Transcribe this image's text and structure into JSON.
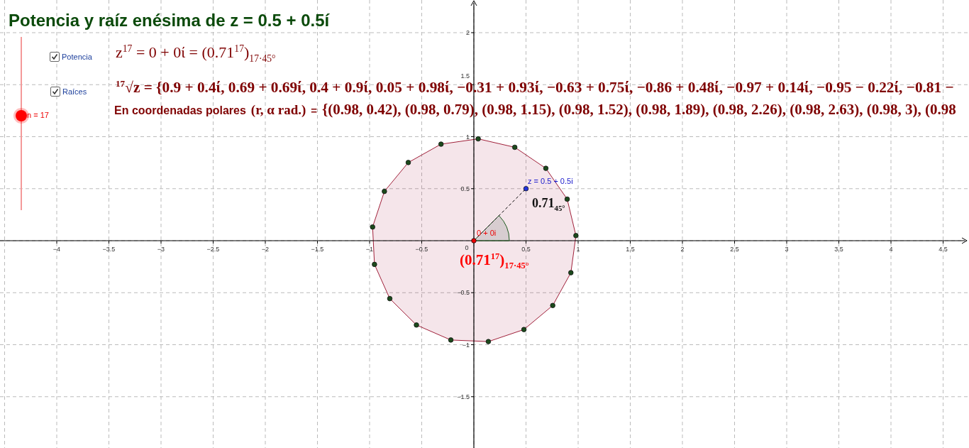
{
  "title": "Potencia y raíz enésima de z = 0.5 + 0.5í",
  "checkboxes": [
    {
      "label": "Potencia",
      "checked": true
    },
    {
      "label": "Raíces",
      "checked": true
    }
  ],
  "slider": {
    "label": "n = 17",
    "level": 0.55
  },
  "power": {
    "formula": "z$^{17}$ = 0 + 0ί = (0.71$^{17}$)$_{17·45°}$"
  },
  "roots": {
    "formula": "$^{17}$√z = {0.9 + 0.4ί, 0.69 + 0.69ί, 0.4 + 0.9ί, 0.05 + 0.98ί, −0.31 + 0.93ί, −0.63 + 0.75ί, −0.86 + 0.48ί, −0.97 + 0.14ί, −0.95 − 0.22ί, −0.81 −"
  },
  "polar": {
    "caption": "En coordenadas polares",
    "pair": "(r, α rad.)",
    "equals": "=",
    "values": "{(0.98, 0.42), (0.98, 0.79), (0.98, 1.15), (0.98, 1.52), (0.98, 1.89), (0.98, 2.26), (0.98, 2.63), (0.98, 3), (0.98"
  },
  "graph": {
    "x_ticks": [
      "−4",
      "−3.5",
      "−3",
      "−2.5",
      "−2",
      "−1.5",
      "−1",
      "−0.5",
      "0",
      "0.5",
      "1",
      "1.5",
      "2",
      "2.5",
      "3",
      "3.5",
      "4",
      "4.5"
    ],
    "y_ticks": [
      "2",
      "1.5",
      "1",
      "0.5",
      "−0.5",
      "−1",
      "−1.5"
    ],
    "labels": [
      {
        "kind": "point",
        "text": "z = 0.5 + 0.5i"
      },
      {
        "kind": "modulus",
        "text": "0.71$_{45°}$"
      },
      {
        "kind": "origin",
        "text": "0 + 0i"
      },
      {
        "kind": "power",
        "text": "(0.71$^{17}$)$_{17·45°}$"
      }
    ]
  }
}
